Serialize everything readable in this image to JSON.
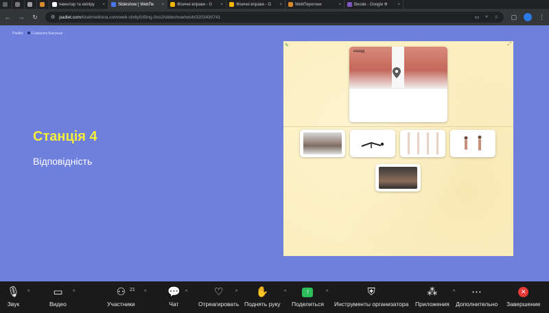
{
  "browser": {
    "tabs": [
      {
        "label": "",
        "color": "#5f6368"
      },
      {
        "label": "",
        "color": "#7a7a7a"
      },
      {
        "label": "",
        "color": "#9e9e9e"
      },
      {
        "label": "",
        "color": "#d88b2a"
      },
      {
        "label": "Інвентар та екіпіру",
        "color": "#ffffff"
      },
      {
        "label": "Slideshow | WebПе",
        "color": "#4a77f0",
        "active": true
      },
      {
        "label": "Фізичні вправи - G",
        "color": "#f4b400"
      },
      {
        "label": "Фізичні вправи - G",
        "color": "#f4b400"
      },
      {
        "label": "WebПерегони",
        "color": "#d88b2a"
      },
      {
        "label": "Висків - Google Ф",
        "color": "#7e57c2"
      }
    ],
    "url_host": "padlet.com",
    "url_path": "/lizahmelinina.com/web-cfx6yl1t5ing-3xo2/slideshow/wish/3202430741",
    "nav_back": "←",
    "nav_forward": "→",
    "nav_reload": "↻",
    "nav_settings": "⚙"
  },
  "page": {
    "brand": "Padlet",
    "author": "Сніжанта Банукак",
    "slide_title": "Станція 4",
    "slide_subtitle": "Відповідність",
    "main_card_label": "назад"
  },
  "taskbar": {
    "audio": "Звук",
    "video": "Видео",
    "participants": "Участники",
    "participants_count": "21",
    "chat": "Чат",
    "react": "Отреагировать",
    "raise_hand": "Поднять руку",
    "share": "Поделиться",
    "host_tools": "Инструменты организатора",
    "apps": "Приложения",
    "more": "Дополнительно",
    "end": "Завершение"
  },
  "colors": {
    "slide_bg": "#6f7fdc",
    "title_yellow": "#f5ee3a",
    "board_bg": "#fbefc0",
    "share_green": "#2dbd5a",
    "end_red": "#e53935"
  }
}
